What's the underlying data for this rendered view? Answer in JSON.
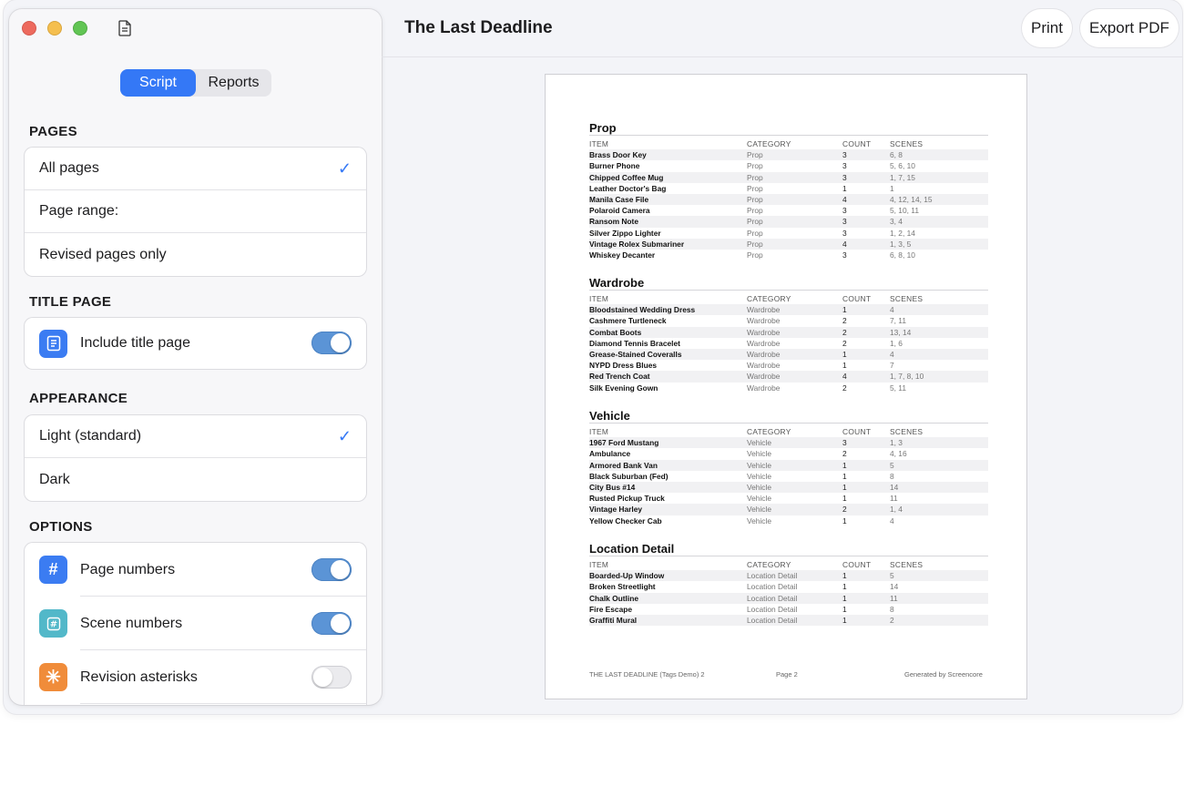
{
  "sidebar": {
    "tabs": [
      "Script",
      "Reports"
    ],
    "sections": {
      "pages": {
        "title": "PAGES",
        "items": [
          "All pages",
          "Page range:",
          "Revised pages only"
        ],
        "check": "✓"
      },
      "title_page": {
        "title": "TITLE PAGE",
        "label": "Include title page",
        "enabled": true
      },
      "appearance": {
        "title": "APPEARANCE",
        "items": [
          "Light (standard)",
          "Dark"
        ],
        "check": "✓"
      },
      "options": {
        "title": "OPTIONS",
        "items": [
          {
            "label": "Page numbers",
            "icon": "hash-icon",
            "glyph": "#",
            "color": "#3b7cf2",
            "enabled": true
          },
          {
            "label": "Scene numbers",
            "icon": "scene-hash-icon",
            "glyph": "#",
            "color": "#52b8c9",
            "enabled": true
          },
          {
            "label": "Revision asterisks",
            "icon": "asterisk-icon",
            "glyph": "✳",
            "color": "#f08c3a",
            "enabled": false
          }
        ]
      }
    }
  },
  "header": {
    "title": "The Last Deadline",
    "print_label": "Print",
    "export_label": "Export PDF"
  },
  "report": {
    "columns": [
      "ITEM",
      "CATEGORY",
      "COUNT",
      "SCENES"
    ],
    "sections": [
      {
        "title": "Prop",
        "rows": [
          [
            "Brass Door Key",
            "Prop",
            "3",
            "6, 8"
          ],
          [
            "Burner Phone",
            "Prop",
            "3",
            "5, 6, 10"
          ],
          [
            "Chipped Coffee Mug",
            "Prop",
            "3",
            "1, 7, 15"
          ],
          [
            "Leather Doctor's Bag",
            "Prop",
            "1",
            "1"
          ],
          [
            "Manila Case File",
            "Prop",
            "4",
            "4, 12, 14, 15"
          ],
          [
            "Polaroid Camera",
            "Prop",
            "3",
            "5, 10, 11"
          ],
          [
            "Ransom Note",
            "Prop",
            "3",
            "3, 4"
          ],
          [
            "Silver Zippo Lighter",
            "Prop",
            "3",
            "1, 2, 14"
          ],
          [
            "Vintage Rolex Submariner",
            "Prop",
            "4",
            "1, 3, 5"
          ],
          [
            "Whiskey Decanter",
            "Prop",
            "3",
            "6, 8, 10"
          ]
        ]
      },
      {
        "title": "Wardrobe",
        "rows": [
          [
            "Bloodstained Wedding Dress",
            "Wardrobe",
            "1",
            "4"
          ],
          [
            "Cashmere Turtleneck",
            "Wardrobe",
            "2",
            "7, 11"
          ],
          [
            "Combat Boots",
            "Wardrobe",
            "2",
            "13, 14"
          ],
          [
            "Diamond Tennis Bracelet",
            "Wardrobe",
            "2",
            "1, 6"
          ],
          [
            "Grease-Stained Coveralls",
            "Wardrobe",
            "1",
            "4"
          ],
          [
            "NYPD Dress Blues",
            "Wardrobe",
            "1",
            "7"
          ],
          [
            "Red Trench Coat",
            "Wardrobe",
            "4",
            "1, 7, 8, 10"
          ],
          [
            "Silk Evening Gown",
            "Wardrobe",
            "2",
            "5, 11"
          ]
        ]
      },
      {
        "title": "Vehicle",
        "rows": [
          [
            "1967 Ford Mustang",
            "Vehicle",
            "3",
            "1, 3"
          ],
          [
            "Ambulance",
            "Vehicle",
            "2",
            "4, 16"
          ],
          [
            "Armored Bank Van",
            "Vehicle",
            "1",
            "5"
          ],
          [
            "Black Suburban (Fed)",
            "Vehicle",
            "1",
            "8"
          ],
          [
            "City Bus #14",
            "Vehicle",
            "1",
            "14"
          ],
          [
            "Rusted Pickup Truck",
            "Vehicle",
            "1",
            "11"
          ],
          [
            "Vintage Harley",
            "Vehicle",
            "2",
            "1, 4"
          ],
          [
            "Yellow Checker Cab",
            "Vehicle",
            "1",
            "4"
          ]
        ]
      },
      {
        "title": "Location Detail",
        "rows": [
          [
            "Boarded-Up Window",
            "Location Detail",
            "1",
            "5"
          ],
          [
            "Broken Streetlight",
            "Location Detail",
            "1",
            "14"
          ],
          [
            "Chalk Outline",
            "Location Detail",
            "1",
            "11"
          ],
          [
            "Fire Escape",
            "Location Detail",
            "1",
            "8"
          ],
          [
            "Graffiti Mural",
            "Location Detail",
            "1",
            "2"
          ]
        ]
      }
    ],
    "footer": {
      "left": "THE LAST DEADLINE (Tags Demo) 2",
      "center": "Page 2",
      "right": "Generated by Screencore"
    }
  }
}
